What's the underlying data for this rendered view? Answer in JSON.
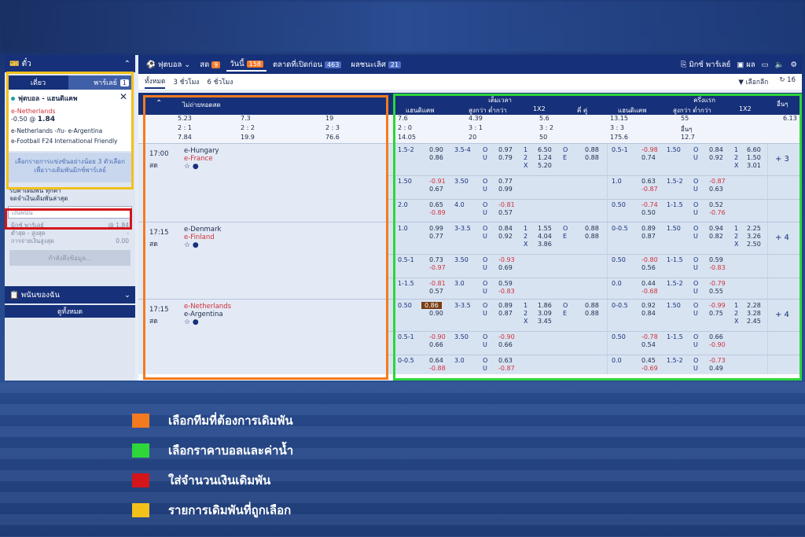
{
  "colors": {
    "orange": "#f47a20",
    "green": "#2ed63a",
    "red": "#d4151b",
    "yellow": "#f2c11a",
    "navy": "#16307a"
  },
  "sidebar": {
    "title": "ตั๋ว",
    "tab_single": "เดี่ยว",
    "tab_parlay": "พาร์เลย์",
    "parlay_count": "1",
    "bet_sport": "ฟุตบอล - แฮนดิแคพ",
    "bet_team": "e-Netherlands",
    "bet_line": "-0.50 @",
    "bet_odds": "1.84",
    "bet_match": "e-Netherlands -กับ- e-Argentina",
    "bet_league": "e-Football F24 International Friendly",
    "notice": "เลือกรายการแข่งขันอย่างน้อย 3 ตัวเลือก เพื่อวางเดิมพันมิกซ์พาร์เลย์",
    "check1": "รับค่าเดิมพัน ทุกค่า",
    "check2": "จดจำเงินเดิมพันล่าสุด",
    "stake_placeholder": "เงินพนัน",
    "mix_label": "มิกซ์ พาร์เลย์",
    "mix_odds": "@ 1.84",
    "minmax_label": "ต่ำสุด - สูงสุด",
    "minmax_val": "-",
    "payout_label": "การจ่ายเงินสูงสุด",
    "payout_val": "0.00",
    "info_button": "กำลังดึงข้อมูล...",
    "my_bets": "พนันของฉัน",
    "view_all": "ดูทั้งหมด"
  },
  "topnav": {
    "sport": "ฟุตบอล",
    "live_label": "สด",
    "live_count": "9",
    "today_label": "วันนี้",
    "today_count": "158",
    "early_label": "ตลาดที่เปิดก่อน",
    "early_count": "463",
    "results_label": "ผลชนะเลิศ",
    "results_count": "21",
    "mix_parlay": "มิกซ์ พาร์เลย์",
    "result": "ผล"
  },
  "subnav": {
    "all": "ทั้งหมด",
    "three_h": "3 ชั่วโมง",
    "six_h": "6 ชั่วโมง",
    "select_league": "เลือกลีก",
    "refresh_count": "16"
  },
  "table": {
    "col_match": "ไม่ถ่ายทอดสด",
    "group_full": "เต็มเวลา",
    "group_half": "ครึ่งแรก",
    "h_hdp": "แฮนดิแคพ",
    "h_ou": "สูงกว่า ต่ำกว่า",
    "h_1x2": "1X2",
    "h_oe": "คี่ คู่",
    "h_hdp2": "แฮนดิแคพ",
    "h_ou2": "สูงกว่า ต่ำกว่า",
    "h_1x22": "1X2",
    "h_more": "อื่นๆ",
    "score_a": [
      "5.23",
      "7.3",
      "19",
      "7.6",
      "4.39",
      "5.6",
      "13.15",
      "55",
      "6.13"
    ],
    "score_b": [
      "2 : 1",
      "2 : 2",
      "2 : 3",
      "2 : 0",
      "3 : 1",
      "3 : 2",
      "3 : 3",
      "อื่นๆ"
    ],
    "score_c": [
      "7.84",
      "19.9",
      "76.6",
      "14.05",
      "20",
      "50",
      "175.6",
      "12.7"
    ],
    "matches": [
      {
        "time": "17:00",
        "status": "สด",
        "home": "e-Hungary",
        "away": "e-France",
        "more": "+ 3",
        "rows": [
          {
            "hdp": "1.5-2",
            "h1": "0.90",
            "h2": "0.86",
            "ou": "3.5-4",
            "o1": "0.97",
            "o2": "0.79",
            "x1": "6.50",
            "x2": "1.24",
            "xx": "5.20",
            "e1": "0.88",
            "e2": "0.88",
            "hdp2": "0.5-1",
            "hh1": "-0.98",
            "hh2": "0.74",
            "ou2": "1.50",
            "oo1": "0.84",
            "oo2": "0.92",
            "y1": "6.60",
            "y2": "1.50",
            "yx": "3.01"
          },
          {
            "hdp": "1.50",
            "h1": "-0.91",
            "h2": "0.67",
            "ou": "3.50",
            "o1": "0.77",
            "o2": "0.99",
            "hdp2": "1.0",
            "hh1": "0.63",
            "hh2": "-0.87",
            "ou2": "1.5-2",
            "oo1": "-0.87",
            "oo2": "0.63"
          },
          {
            "hdp": "2.0",
            "h1": "0.65",
            "h2": "-0.89",
            "ou": "4.0",
            "o1": "-0.81",
            "o2": "0.57",
            "hdp2": "0.50",
            "hh1": "-0.74",
            "hh2": "0.50",
            "ou2": "1-1.5",
            "oo1": "0.52",
            "oo2": "-0.76"
          }
        ]
      },
      {
        "time": "17:15",
        "status": "สด",
        "home": "e-Denmark",
        "away": "e-Finland",
        "more": "+ 4",
        "rows": [
          {
            "hdp": "1.0",
            "h1": "0.99",
            "h2": "0.77",
            "ou": "3-3.5",
            "o1": "0.84",
            "o2": "0.92",
            "x1": "1.55",
            "x2": "4.04",
            "xx": "3.86",
            "e1": "0.88",
            "e2": "0.88",
            "hdp2": "0-0.5",
            "hh1": "0.89",
            "hh2": "0.87",
            "ou2": "1.50",
            "oo1": "0.94",
            "oo2": "0.82",
            "y1": "2.25",
            "y2": "3.26",
            "yx": "2.50"
          },
          {
            "hdp": "0.5-1",
            "h1": "0.73",
            "h2": "-0.97",
            "ou": "3.50",
            "o1": "-0.93",
            "o2": "0.69",
            "hdp2": "0.50",
            "hh1": "-0.80",
            "hh2": "0.56",
            "ou2": "1-1.5",
            "oo1": "0.59",
            "oo2": "-0.83"
          },
          {
            "hdp": "1-1.5",
            "h1": "-0.81",
            "h2": "0.57",
            "ou": "3.0",
            "o1": "0.59",
            "o2": "-0.83",
            "hdp2": "0.0",
            "hh1": "0.44",
            "hh2": "-0.68",
            "ou2": "1.5-2",
            "oo1": "-0.79",
            "oo2": "0.55"
          }
        ]
      },
      {
        "time": "17:15",
        "status": "สด",
        "home": "e-Netherlands",
        "away": "e-Argentina",
        "more": "+ 4",
        "rows": [
          {
            "hdp": "0.50",
            "h1": "0.86",
            "h2": "0.90",
            "ou": "3-3.5",
            "o1": "0.89",
            "o2": "0.87",
            "x1": "1.86",
            "x2": "3.09",
            "xx": "3.45",
            "e1": "0.88",
            "e2": "0.88",
            "hdp2": "0-0.5",
            "hh1": "0.92",
            "hh2": "0.84",
            "ou2": "1.50",
            "oo1": "-0.99",
            "oo2": "0.75",
            "y1": "2.28",
            "y2": "3.28",
            "yx": "2.45"
          },
          {
            "hdp": "0.5-1",
            "h1": "-0.90",
            "h2": "0.66",
            "ou": "3.50",
            "o1": "-0.90",
            "o2": "0.66",
            "hdp2": "0.50",
            "hh1": "-0.78",
            "hh2": "0.54",
            "ou2": "1-1.5",
            "oo1": "0.66",
            "oo2": "-0.90"
          },
          {
            "hdp": "0-0.5",
            "h1": "0.64",
            "h2": "-0.88",
            "ou": "3.0",
            "o1": "0.63",
            "o2": "-0.87",
            "hdp2": "0.0",
            "hh1": "0.45",
            "hh2": "-0.69",
            "ou2": "1.5-2",
            "oo1": "-0.73",
            "oo2": "0.49"
          }
        ]
      }
    ]
  },
  "legend": [
    {
      "label": "เลือกทีมที่ต้องการเดิมพัน",
      "color": "#f47a20"
    },
    {
      "label": "เลือกราคาบอลและค่าน้ำ",
      "color": "#2ed63a"
    },
    {
      "label": "ใส่จำนวนเงินเดิมพัน",
      "color": "#d4151b"
    },
    {
      "label": "รายการเดิมพันที่ถูกเลือก",
      "color": "#f2c11a"
    }
  ]
}
